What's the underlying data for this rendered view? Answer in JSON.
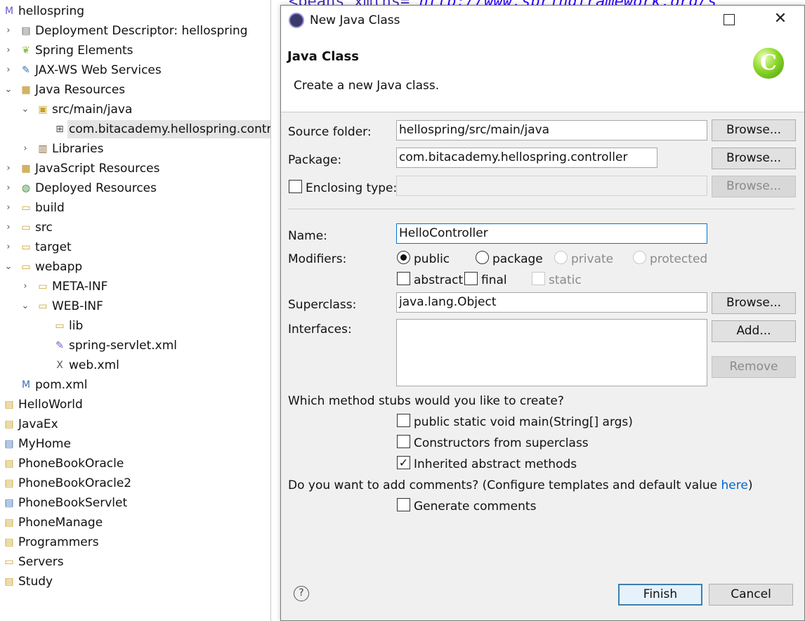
{
  "explorer": {
    "items": [
      {
        "label": "hellospring",
        "icon": "maven-project-icon",
        "glyph": "M",
        "color": "#6a5acd",
        "expanded": true,
        "twisty": ""
      },
      {
        "label": "Deployment Descriptor: hellospring",
        "icon": "deployment-descriptor-icon",
        "glyph": "▤",
        "color": "#666",
        "twisty": "›"
      },
      {
        "label": "Spring Elements",
        "icon": "spring-leaf-icon",
        "glyph": "❦",
        "color": "#8bc34a",
        "twisty": "›"
      },
      {
        "label": "JAX-WS Web Services",
        "icon": "web-services-icon",
        "glyph": "✎",
        "color": "#3d6fb5",
        "twisty": "›"
      },
      {
        "label": "Java Resources",
        "icon": "java-resources-icon",
        "glyph": "▦",
        "color": "#b8860b",
        "twisty": "⌄"
      },
      {
        "label": "src/main/java",
        "icon": "source-folder-icon",
        "glyph": "▣",
        "color": "#c9a227",
        "twisty": "⌄"
      },
      {
        "label": "com.bitacademy.hellospring.contro",
        "icon": "package-icon",
        "glyph": "⊞",
        "color": "#555",
        "twisty": ""
      },
      {
        "label": "Libraries",
        "icon": "libraries-icon",
        "glyph": "▥",
        "color": "#8a6d3b",
        "twisty": "›"
      },
      {
        "label": "JavaScript Resources",
        "icon": "javascript-resources-icon",
        "glyph": "▦",
        "color": "#b8860b",
        "twisty": "›"
      },
      {
        "label": "Deployed Resources",
        "icon": "deployed-resources-icon",
        "glyph": "◍",
        "color": "#3f8f3f",
        "twisty": "›"
      },
      {
        "label": "build",
        "icon": "folder-icon",
        "glyph": "▭",
        "color": "#c9a227",
        "twisty": "›"
      },
      {
        "label": "src",
        "icon": "folder-icon",
        "glyph": "▭",
        "color": "#c9a227",
        "twisty": "›"
      },
      {
        "label": "target",
        "icon": "folder-icon",
        "glyph": "▭",
        "color": "#c9a227",
        "twisty": "›"
      },
      {
        "label": "webapp",
        "icon": "web-folder-icon",
        "glyph": "▭",
        "color": "#c9a227",
        "twisty": "⌄"
      },
      {
        "label": "META-INF",
        "icon": "folder-icon",
        "glyph": "▭",
        "color": "#c9a227",
        "twisty": "›"
      },
      {
        "label": "WEB-INF",
        "icon": "web-folder-icon",
        "glyph": "▭",
        "color": "#c9a227",
        "twisty": "⌄"
      },
      {
        "label": "lib",
        "icon": "folder-icon",
        "glyph": "▭",
        "color": "#c9a227",
        "twisty": ""
      },
      {
        "label": "spring-servlet.xml",
        "icon": "spring-xml-icon",
        "glyph": "✎",
        "color": "#6a5acd",
        "twisty": ""
      },
      {
        "label": "web.xml",
        "icon": "xml-file-icon",
        "glyph": "X",
        "color": "#555",
        "twisty": ""
      },
      {
        "label": "pom.xml",
        "icon": "pom-file-icon",
        "glyph": "M",
        "color": "#3d6fb5",
        "twisty": ""
      },
      {
        "label": "HelloWorld",
        "icon": "project-icon",
        "glyph": "▤",
        "color": "#c9a227",
        "twisty": ""
      },
      {
        "label": "JavaEx",
        "icon": "project-icon",
        "glyph": "▤",
        "color": "#c9a227",
        "twisty": ""
      },
      {
        "label": "MyHome",
        "icon": "project-icon",
        "glyph": "▤",
        "color": "#3d6fb5",
        "twisty": ""
      },
      {
        "label": "PhoneBookOracle",
        "icon": "project-icon",
        "glyph": "▤",
        "color": "#c9a227",
        "twisty": ""
      },
      {
        "label": "PhoneBookOracle2",
        "icon": "project-icon",
        "glyph": "▤",
        "color": "#c9a227",
        "twisty": ""
      },
      {
        "label": "PhoneBookServlet",
        "icon": "project-icon",
        "glyph": "▤",
        "color": "#3d6fb5",
        "twisty": ""
      },
      {
        "label": "PhoneManage",
        "icon": "project-icon",
        "glyph": "▤",
        "color": "#c9a227",
        "twisty": ""
      },
      {
        "label": "Programmers",
        "icon": "project-icon",
        "glyph": "▤",
        "color": "#c9a227",
        "twisty": ""
      },
      {
        "label": "Servers",
        "icon": "servers-folder-icon",
        "glyph": "▭",
        "color": "#c9a227",
        "twisty": ""
      },
      {
        "label": "Study",
        "icon": "project-icon",
        "glyph": "▤",
        "color": "#c9a227",
        "twisty": ""
      }
    ]
  },
  "editor": {
    "code_prefix": "<beans ",
    "code_attr": "xmlns=",
    "code_value": "\"http://www.springframework.org/s"
  },
  "dialog": {
    "window_title": "New Java Class",
    "banner_title": "Java Class",
    "banner_desc": "Create a new Java class.",
    "banner_logo_glyph": "C",
    "source_folder": {
      "label": "Source folder:",
      "value": "hellospring/src/main/java",
      "browse": "Browse..."
    },
    "package": {
      "label": "Package:",
      "value": "com.bitacademy.hellospring.controller",
      "browse": "Browse..."
    },
    "enclosing": {
      "label": "Enclosing type:",
      "value": "",
      "browse": "Browse...",
      "checked": false
    },
    "name": {
      "label": "Name:",
      "value": "HelloController"
    },
    "modifiers": {
      "label": "Modifiers:",
      "public": "public",
      "package": "package",
      "private": "private",
      "protected": "protected",
      "abstract": "abstract",
      "final": "final",
      "static": "static",
      "selected": "public"
    },
    "superclass": {
      "label": "Superclass:",
      "value": "java.lang.Object",
      "browse": "Browse..."
    },
    "interfaces": {
      "label": "Interfaces:",
      "add": "Add...",
      "remove": "Remove"
    },
    "stubs": {
      "question": "Which method stubs would you like to create?",
      "main": "public static void main(String[] args)",
      "constructors": "Constructors from superclass",
      "inherited": "Inherited abstract methods",
      "main_checked": false,
      "constructors_checked": false,
      "inherited_checked": true
    },
    "comments": {
      "question_prefix": "Do you want to add comments? (Configure templates and default value ",
      "link": "here",
      "question_suffix": ")",
      "generate": "Generate comments",
      "generate_checked": false
    },
    "finish": "Finish",
    "cancel": "Cancel",
    "help_glyph": "?",
    "close_glyph": "✕"
  }
}
